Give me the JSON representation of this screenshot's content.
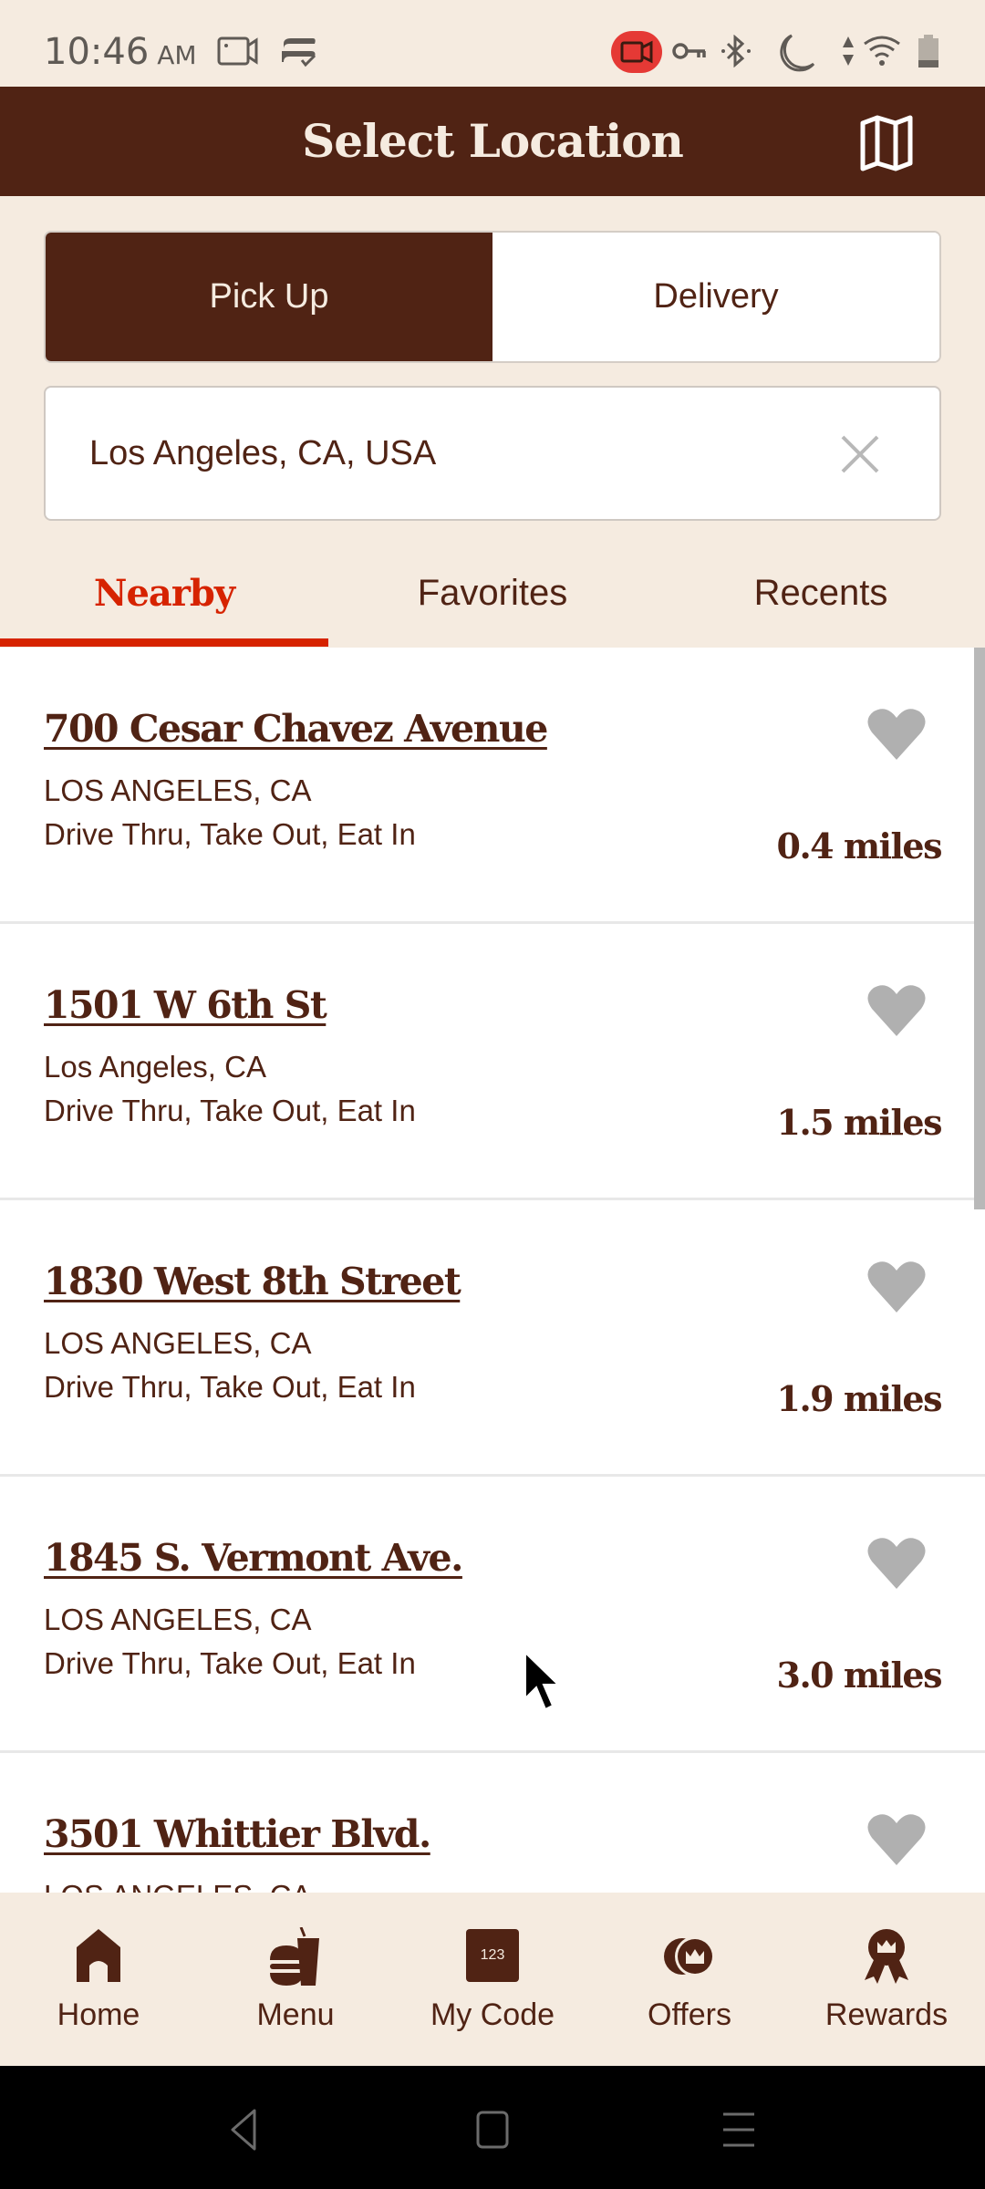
{
  "status_bar": {
    "time": "10:46",
    "ampm": "AM",
    "icons_left": [
      "screen-record-icon",
      "sync-icon"
    ],
    "icons_right": [
      "recording-indicator-icon",
      "vpn-key-icon",
      "bluetooth-icon",
      "do-not-disturb-icon",
      "data-arrows-icon",
      "wifi-icon",
      "battery-icon"
    ],
    "recording_color": "#e53935"
  },
  "header": {
    "title": "Select Location",
    "map_icon": "map-icon"
  },
  "order_type": {
    "options": [
      {
        "label": "Pick Up",
        "selected": true
      },
      {
        "label": "Delivery",
        "selected": false
      }
    ]
  },
  "search": {
    "value": "Los Angeles, CA, USA",
    "clear_icon": "close-icon"
  },
  "tabs": [
    {
      "label": "Nearby",
      "active": true
    },
    {
      "label": "Favorites",
      "active": false
    },
    {
      "label": "Recents",
      "active": false
    }
  ],
  "locations": [
    {
      "name": "700 Cesar Chavez Avenue",
      "city": "LOS ANGELES, CA",
      "services": "Drive Thru, Take Out, Eat In",
      "distance": "0.4 miles",
      "favorite": false
    },
    {
      "name": "1501 W 6th St",
      "city": "Los Angeles, CA",
      "services": "Drive Thru, Take Out, Eat In",
      "distance": "1.5 miles",
      "favorite": false
    },
    {
      "name": "1830 West 8th Street",
      "city": "LOS ANGELES, CA",
      "services": "Drive Thru, Take Out, Eat In",
      "distance": "1.9 miles",
      "favorite": false
    },
    {
      "name": "1845 S. Vermont Ave.",
      "city": "LOS ANGELES, CA",
      "services": "Drive Thru, Take Out, Eat In",
      "distance": "3.0 miles",
      "favorite": false
    },
    {
      "name": "3501 Whittier Blvd.",
      "city": "LOS ANGELES, CA",
      "services": "",
      "distance": "",
      "favorite": false
    }
  ],
  "bottom_nav": [
    {
      "label": "Home",
      "icon": "home-icon"
    },
    {
      "label": "Menu",
      "icon": "burger-drink-icon"
    },
    {
      "label": "My Code",
      "icon": "code-card-icon",
      "icon_text": "123"
    },
    {
      "label": "Offers",
      "icon": "offers-coins-icon"
    },
    {
      "label": "Rewards",
      "icon": "rewards-ribbon-icon"
    }
  ],
  "colors": {
    "brand_brown": "#502314",
    "cream": "#f5ebe0",
    "accent_red": "#d62300",
    "heart_gray": "#b0b0b0"
  }
}
